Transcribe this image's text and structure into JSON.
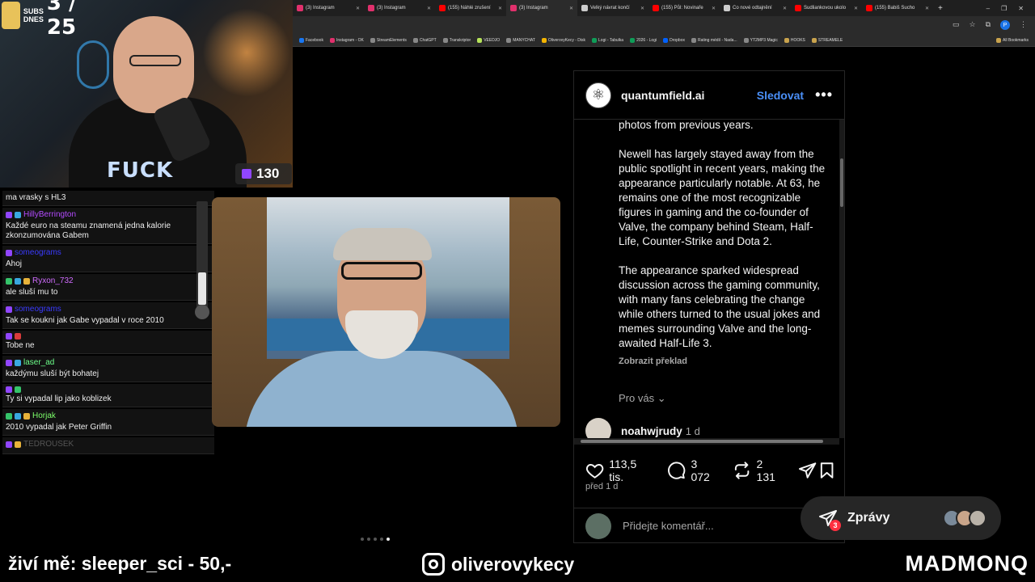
{
  "browser": {
    "tabs": [
      {
        "label": "(3) Instagram",
        "color": "#e1306c"
      },
      {
        "label": "(3) Instagram",
        "color": "#e1306c"
      },
      {
        "label": "(155) Náhlé zrušení",
        "color": "#ff0000"
      },
      {
        "label": "(3) Instagram",
        "color": "#e1306c"
      },
      {
        "label": "Velký návrat končí",
        "color": "#cccccc"
      },
      {
        "label": "(155) Půl: Novinaře",
        "color": "#ff0000"
      },
      {
        "label": "Co nové odtajnění",
        "color": "#cccccc"
      },
      {
        "label": "Sudliankovou ukolo",
        "color": "#ff0000"
      },
      {
        "label": "(155) Babiš Sucho",
        "color": "#ff0000"
      }
    ],
    "new_tab": "+",
    "window_controls": [
      "–",
      "❐",
      "✕"
    ],
    "profile_initial": "P",
    "bookmarks": [
      "Facebook",
      "Instagram - OK",
      "StreamElements",
      "ChatGPT",
      "Transkriptor",
      "VEEDJO",
      "MANYCHAT",
      "OliverovyKecy - Disk",
      "Logi - Tabulka",
      "2026 - Logi",
      "Dropbox",
      "Rating médií - Nada...",
      "YT2MP3 Magic",
      "HOOKS",
      "STREAMELE"
    ],
    "all_bookmarks": "All Bookmarks"
  },
  "webcam": {
    "subs_label_1": "SUBS",
    "subs_label_2": "DNES",
    "subs_count": "3 / 25",
    "shirt_text": "FUCK",
    "viewer_count": "130"
  },
  "chat": {
    "messages": [
      {
        "user": "",
        "user_color": "#ffffff",
        "badges": [],
        "text": "ma vrasky s HL3"
      },
      {
        "user": "HillyBerrington",
        "user_color": "#b44bff",
        "badges": [
          "b-purple",
          "b-blue"
        ],
        "text": "Každé euro na steamu znamená jedna kalorie zkonzumována Gabem"
      },
      {
        "user": "someograms",
        "user_color": "#3a3aff",
        "badges": [
          "b-purple"
        ],
        "text": "Ahoj"
      },
      {
        "user": "Ryxon_732",
        "user_color": "#d06bff",
        "badges": [
          "b-green",
          "b-blue",
          "b-gold"
        ],
        "text": "ale sluší mu to"
      },
      {
        "user": "someograms",
        "user_color": "#3a3aff",
        "badges": [
          "b-purple"
        ],
        "text": "Tak se koukni jak Gabe vypadal v roce 2010"
      },
      {
        "user": "",
        "user_color": "#ffffff",
        "badges": [
          "b-purple",
          "b-red"
        ],
        "text": "Tobe ne"
      },
      {
        "user": "laser_ad",
        "user_color": "#6dff8a",
        "badges": [
          "b-purple",
          "b-blue"
        ],
        "text": "každýmu sluší být bohatej"
      },
      {
        "user": "",
        "user_color": "#ffffff",
        "badges": [
          "b-purple",
          "b-green"
        ],
        "text": "Ty si vypadal lip jako koblizek"
      },
      {
        "user": "Horjak",
        "user_color": "#7dff6b",
        "badges": [
          "b-green",
          "b-blue",
          "b-gold"
        ],
        "text": "2010 vypadal jak Peter Griffin"
      },
      {
        "user": "TEDROUSEK",
        "user_color": "#555555",
        "badges": [
          "b-purple",
          "b-gold"
        ],
        "text": ""
      }
    ]
  },
  "post": {
    "username": "quantumfield.ai",
    "follow_label": "Sledovat",
    "more_label": "•••",
    "caption_paragraphs": [
      "photos from previous years.",
      "Newell has largely stayed away from the public spotlight in recent years, making the appearance particularly notable. At 63, he remains one of the most recognizable figures in gaming and the co-founder of Valve, the company behind Steam, Half-Life, Counter-Strike and Dota 2.",
      "The appearance sparked widespread discussion across the gaming community, with many fans celebrating the change while others turned to the usual jokes and memes surrounding Valve and the long-awaited Half-Life 3."
    ],
    "translate_label": "Zobrazit překlad",
    "for_you_label": "Pro vás",
    "comment_user": "noahwjrudy",
    "comment_time": "1 d",
    "likes": "113,5 tis.",
    "comments": "3 072",
    "reposts": "2 131",
    "date": "před 1 d",
    "add_comment_placeholder": "Přidejte komentář..."
  },
  "messages_pill": {
    "label": "Zprávy",
    "unread": "3"
  },
  "ticker": {
    "left_text": "živí mě: sleeper_sci - 50,-",
    "instagram_handle": "oliverovykecy",
    "brand": "MADMONQ"
  }
}
